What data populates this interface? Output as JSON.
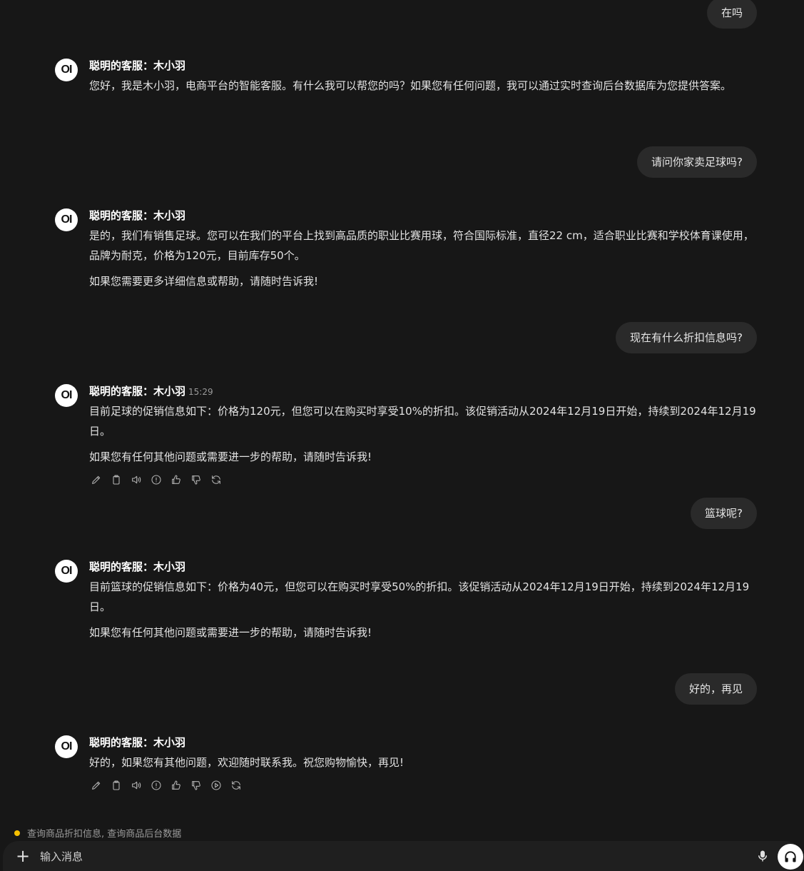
{
  "conversation": {
    "user_messages": [
      "在吗",
      "请问你家卖足球吗?",
      "现在有什么折扣信息吗?",
      "篮球呢?",
      "好的，再见"
    ],
    "assistant": {
      "name": "聪明的客服：木小羽",
      "avatar_text": "OI",
      "messages": [
        {
          "paragraphs": [
            "您好，我是木小羽，电商平台的智能客服。有什么我可以帮您的吗？如果您有任何问题，我可以通过实时查询后台数据库为您提供答案。"
          ]
        },
        {
          "paragraphs": [
            "是的，我们有销售足球。您可以在我们的平台上找到高品质的职业比赛用球，符合国际标准，直径22 cm，适合职业比赛和学校体育课使用，品牌为耐克，价格为120元，目前库存50个。",
            "如果您需要更多详细信息或帮助，请随时告诉我!"
          ]
        },
        {
          "time": "15:29",
          "paragraphs": [
            "目前足球的促销信息如下：价格为120元，但您可以在购买时享受10%的折扣。该促销活动从2024年12月19日开始，持续到2024年12月19日。",
            "如果您有任何其他问题或需要进一步的帮助，请随时告诉我!"
          ]
        },
        {
          "paragraphs": [
            "目前篮球的促销信息如下：价格为40元，但您可以在购买时享受50%的折扣。该促销活动从2024年12月19日开始，持续到2024年12月19日。",
            "如果您有任何其他问题或需要进一步的帮助，请随时告诉我!"
          ]
        },
        {
          "paragraphs": [
            "好的，如果您有其他问题，欢迎随时联系我。祝您购物愉快，再见!"
          ]
        }
      ]
    }
  },
  "action_icons": {
    "message_3": [
      "edit-icon",
      "copy-icon",
      "read-aloud-icon",
      "info-icon",
      "thumbs-up-icon",
      "thumbs-down-icon",
      "regenerate-icon"
    ],
    "message_5": [
      "edit-icon",
      "copy-icon",
      "read-aloud-icon",
      "info-icon",
      "thumbs-up-icon",
      "thumbs-down-icon",
      "continue-icon",
      "regenerate-icon"
    ]
  },
  "status": {
    "text": "查询商品折扣信息, 查询商品后台数据",
    "dot_color": "#f5c000"
  },
  "input": {
    "placeholder": "输入消息"
  }
}
